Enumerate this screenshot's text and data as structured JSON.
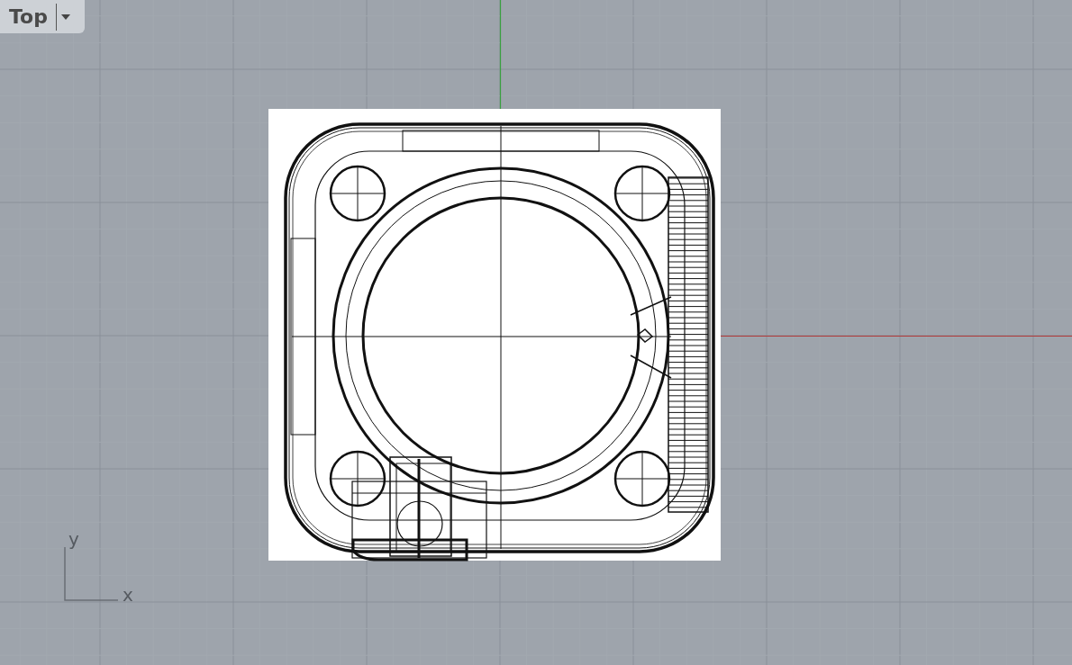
{
  "viewport": {
    "label": "Top"
  },
  "axis_icon": {
    "y_label": "y",
    "x_label": "x"
  }
}
